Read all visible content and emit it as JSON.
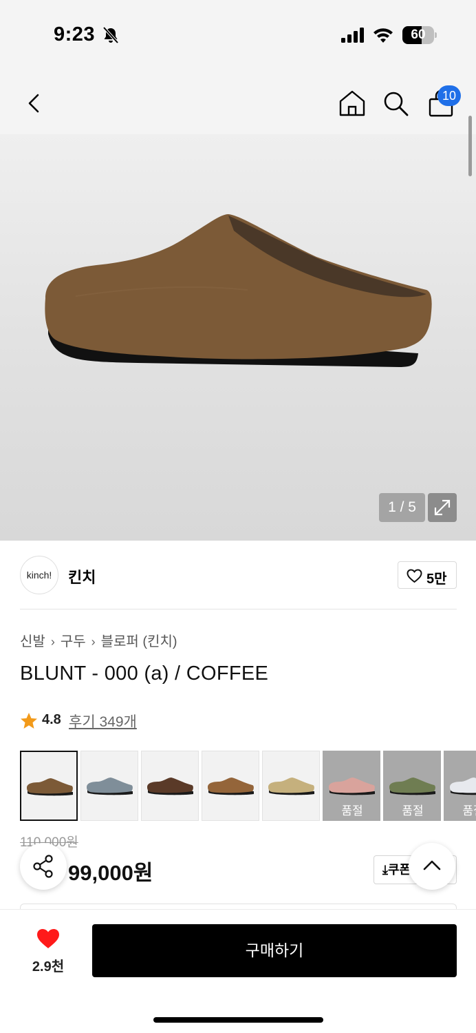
{
  "status_bar": {
    "time": "9:23",
    "battery_level": 60,
    "battery_text": "60"
  },
  "header": {
    "cart_count": "10"
  },
  "gallery": {
    "counter": "1 / 5",
    "shoe_color": "#7c5a37"
  },
  "brand": {
    "logo_text": "kinch!",
    "name": "킨치",
    "likes": "5만"
  },
  "breadcrumb": {
    "items": [
      "신발",
      "구두",
      "블로퍼 (킨치)"
    ],
    "separator": "›"
  },
  "product": {
    "title": "BLUNT - 000 (a) / COFFEE",
    "rating": "4.8",
    "review_link": "후기 349개",
    "original_price": "110,000원",
    "sale_price": "99,000원"
  },
  "options": [
    {
      "color": "#7c5a37",
      "soldout": false,
      "selected": true
    },
    {
      "color": "#7f8e99",
      "soldout": false,
      "selected": false
    },
    {
      "color": "#5a3a28",
      "soldout": false,
      "selected": false
    },
    {
      "color": "#94653a",
      "soldout": false,
      "selected": false
    },
    {
      "color": "#c5b07d",
      "soldout": false,
      "selected": false
    },
    {
      "color": "#d9a39c",
      "soldout": true,
      "selected": false,
      "label": "품절"
    },
    {
      "color": "#6f7d52",
      "soldout": true,
      "selected": false,
      "label": "품절"
    },
    {
      "color": "#e7e9ee",
      "soldout": true,
      "selected": false,
      "label": "품절"
    }
  ],
  "coupon": {
    "label": "쿠폰받기"
  },
  "bottom_bar": {
    "wish_count": "2.9천",
    "buy_label": "구매하기"
  },
  "colors": {
    "badge_blue": "#1f6fe8",
    "star": "#f29a1a",
    "heart_red": "#ff1a1a"
  }
}
